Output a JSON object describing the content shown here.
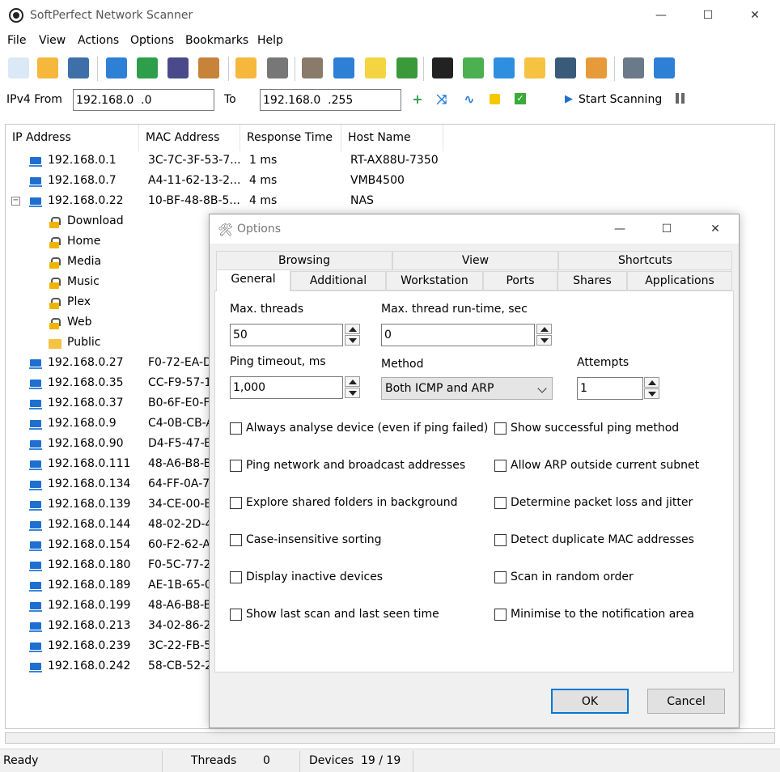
{
  "window": {
    "title": "SoftPerfect Network Scanner",
    "controls": {
      "minimize": "—",
      "maximize": "☐",
      "close": "✕"
    }
  },
  "menu": [
    "File",
    "View",
    "Actions",
    "Options",
    "Bookmarks",
    "Help"
  ],
  "range": {
    "from_label": "IPv4 From",
    "from_value": "192.168.0  .0",
    "to_label": "To",
    "to_value": "192.168.0  .255",
    "start_label": "Start Scanning"
  },
  "columns": [
    "IP Address",
    "MAC Address",
    "Response Time",
    "Host Name"
  ],
  "rows": [
    {
      "ip": "192.168.0.1",
      "mac": "3C-7C-3F-53-7...",
      "resp": "1 ms",
      "host": "RT-AX88U-7350"
    },
    {
      "ip": "192.168.0.7",
      "mac": "A4-11-62-13-2...",
      "resp": "4 ms",
      "host": "VMB4500"
    },
    {
      "ip": "192.168.0.22",
      "mac": "10-BF-48-8B-5...",
      "resp": "4 ms",
      "host": "NAS"
    }
  ],
  "shares": [
    {
      "name": "Download",
      "icon": "lock-icon"
    },
    {
      "name": "Home",
      "icon": "lock-icon"
    },
    {
      "name": "Media",
      "icon": "lock-icon"
    },
    {
      "name": "Music",
      "icon": "lock-icon"
    },
    {
      "name": "Plex",
      "icon": "lock-icon"
    },
    {
      "name": "Web",
      "icon": "lock-icon"
    },
    {
      "name": "Public",
      "icon": "folder-icon"
    }
  ],
  "more_rows": [
    {
      "ip": "192.168.0.27",
      "mac": "F0-72-EA-D"
    },
    {
      "ip": "192.168.0.35",
      "mac": "CC-F9-57-1"
    },
    {
      "ip": "192.168.0.37",
      "mac": "B0-6F-E0-F"
    },
    {
      "ip": "192.168.0.9",
      "mac": "C4-0B-CB-A"
    },
    {
      "ip": "192.168.0.90",
      "mac": "D4-F5-47-B"
    },
    {
      "ip": "192.168.0.111",
      "mac": "48-A6-B8-B"
    },
    {
      "ip": "192.168.0.134",
      "mac": "64-FF-0A-7"
    },
    {
      "ip": "192.168.0.139",
      "mac": "34-CE-00-E"
    },
    {
      "ip": "192.168.0.144",
      "mac": "48-02-2D-4"
    },
    {
      "ip": "192.168.0.154",
      "mac": "60-F2-62-A"
    },
    {
      "ip": "192.168.0.180",
      "mac": "F0-5C-77-2"
    },
    {
      "ip": "192.168.0.189",
      "mac": "AE-1B-65-0"
    },
    {
      "ip": "192.168.0.199",
      "mac": "48-A6-B8-B"
    },
    {
      "ip": "192.168.0.213",
      "mac": "34-02-86-2"
    },
    {
      "ip": "192.168.0.239",
      "mac": "3C-22-FB-5"
    },
    {
      "ip": "192.168.0.242",
      "mac": "58-CB-52-2"
    }
  ],
  "status": {
    "state": "Ready",
    "threads_label": "Threads",
    "threads_value": "0",
    "devices_label": "Devices",
    "devices_value": "19 / 19"
  },
  "dialog": {
    "title": "Options",
    "tabs_top": [
      "Browsing",
      "View",
      "Shortcuts"
    ],
    "tabs_bottom": [
      "General",
      "Additional",
      "Workstation",
      "Ports",
      "Shares",
      "Applications"
    ],
    "active_tab": "General",
    "max_threads_label": "Max. threads",
    "max_threads_value": "50",
    "max_runtime_label": "Max. thread run-time, sec",
    "max_runtime_value": "0",
    "ping_timeout_label": "Ping timeout, ms",
    "ping_timeout_value": "1,000",
    "method_label": "Method",
    "method_value": "Both ICMP and ARP",
    "attempts_label": "Attempts",
    "attempts_value": "1",
    "checkboxes_left": [
      "Always analyse device (even if ping failed)",
      "Ping network and broadcast addresses",
      "Explore shared folders in background",
      "Case-insensitive sorting",
      "Display inactive devices",
      "Show last scan and last seen time"
    ],
    "checkboxes_right": [
      "Show successful ping method",
      "Allow ARP outside current subnet",
      "Determine packet loss and jitter",
      "Detect duplicate MAC addresses",
      "Scan in random order",
      "Minimise to the notification area"
    ],
    "ok_label": "OK",
    "cancel_label": "Cancel"
  },
  "toolbar_icons": [
    {
      "name": "new-icon",
      "color": "#dbe8f6"
    },
    {
      "name": "open-folder-icon",
      "color": "#f5b83d"
    },
    {
      "name": "save-icon",
      "color": "#3e6fa8"
    },
    {
      "name": "expand-tree-icon",
      "color": "#2e7fd6"
    },
    {
      "name": "add-tree-icon",
      "color": "#2e9e4a"
    },
    {
      "name": "find-icon",
      "color": "#4a4a8a"
    },
    {
      "name": "clipboard-icon",
      "color": "#c8833a"
    },
    {
      "name": "filter-folder-icon",
      "color": "#f5b83d"
    },
    {
      "name": "filter-icon",
      "color": "#777777"
    },
    {
      "name": "options-tools-icon",
      "color": "#8a7a6a"
    },
    {
      "name": "network-computer-icon",
      "color": "#2e7fd6"
    },
    {
      "name": "lightbulb-icon",
      "color": "#f5d442"
    },
    {
      "name": "ip-board-icon",
      "color": "#3a9a3a"
    },
    {
      "name": "wmi-icon",
      "color": "#222222"
    },
    {
      "name": "registry-icon",
      "color": "#4caf50"
    },
    {
      "name": "services-gear-icon",
      "color": "#2e8fe0"
    },
    {
      "name": "shared-folder-icon",
      "color": "#f5c242"
    },
    {
      "name": "monitor-icon",
      "color": "#3a5a7a"
    },
    {
      "name": "users-icon",
      "color": "#e69a3a"
    },
    {
      "name": "help-icon",
      "color": "#6a7a8a"
    },
    {
      "name": "web-globe-icon",
      "color": "#2e7fd6"
    }
  ]
}
